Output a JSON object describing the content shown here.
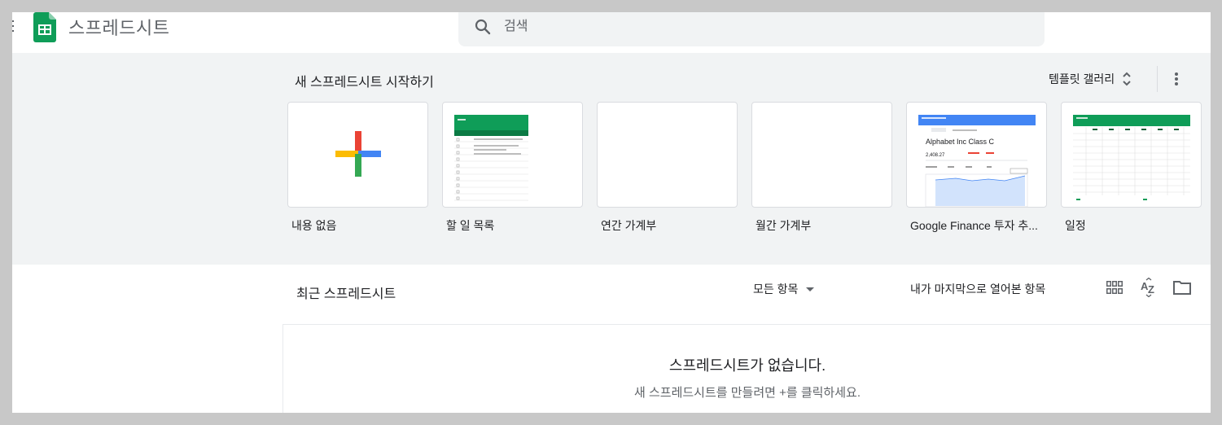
{
  "header": {
    "app_title": "스프레드시트",
    "search_placeholder": "검색",
    "logo_color": "#0f9d58"
  },
  "gallery": {
    "title": "새 스프레드시트 시작하기",
    "gallery_link": "템플릿 갤러리",
    "templates": [
      {
        "label": "내용 없음",
        "thumb": "blank-plus"
      },
      {
        "label": "할 일 목록",
        "thumb": "todo-list"
      },
      {
        "label": "연간 가계부",
        "thumb": "blank"
      },
      {
        "label": "월간 가계부",
        "thumb": "blank"
      },
      {
        "label": "Google Finance 투자 추...",
        "thumb": "finance",
        "thumb_heading": "Alphabet Inc Class C",
        "thumb_value": "2,408.27"
      },
      {
        "label": "일정",
        "thumb": "schedule"
      }
    ]
  },
  "recent": {
    "title": "최근 스프레드시트",
    "owner_filter": "모든 항목",
    "sort_label": "내가 마지막으로 열어본 항목",
    "empty_title": "스프레드시트가 없습니다.",
    "empty_subtitle": "새 스프레드시트를 만들려면 +를 클릭하세요."
  },
  "colors": {
    "sheets_green": "#0f9d58",
    "band_grey": "#f1f3f4",
    "finance_blue": "#4285f4"
  }
}
